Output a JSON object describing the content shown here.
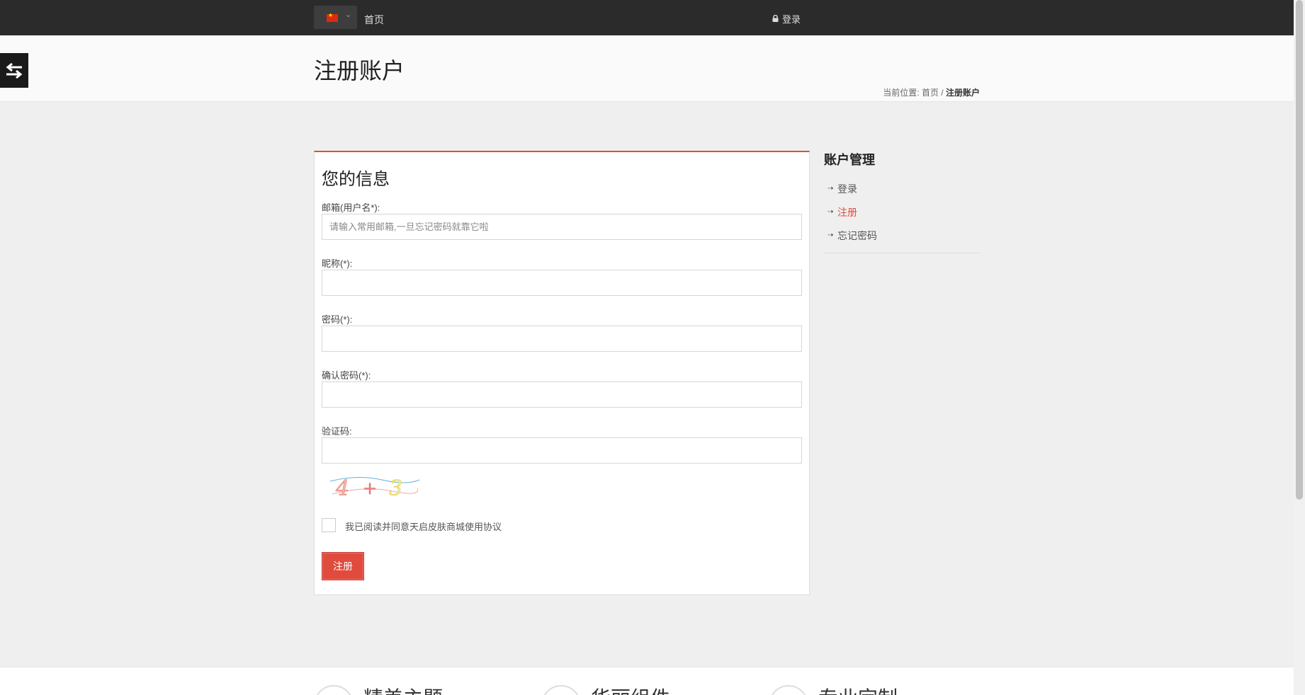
{
  "topbar": {
    "language": "zh-CN",
    "flag_icon": "china-flag-icon",
    "home": "首页",
    "login": "登录"
  },
  "page": {
    "title": "注册账户"
  },
  "breadcrumb": {
    "prefix": "当前位置:",
    "home": "首页",
    "separator": "/",
    "current": "注册账户"
  },
  "form": {
    "title": "您的信息",
    "email_label": "邮箱(用户名*):",
    "email_placeholder": "请输入常用邮箱,一旦忘记密码就靠它啦",
    "email_value": "",
    "nickname_label": "昵称(*):",
    "nickname_value": "",
    "password_label": "密码(*):",
    "confirm_label": "确认密码(*):",
    "captcha_label": "验证码:",
    "captcha_value": "",
    "captcha_image_text": "4 + 3",
    "agree_label": "我已阅读并同意天启皮肤商城使用协议",
    "agree_checked": false,
    "submit": "注册"
  },
  "sidebar": {
    "title": "账户管理",
    "items": [
      {
        "label": "登录",
        "active": false
      },
      {
        "label": "注册",
        "active": true
      },
      {
        "label": "忘记密码",
        "active": false
      }
    ]
  },
  "features": [
    {
      "title": "精美主题"
    },
    {
      "title": "华丽组件"
    },
    {
      "title": "专业定制"
    }
  ],
  "colors": {
    "accent": "#e04b3d",
    "topbar": "#2b2b2b",
    "background": "#efefef"
  }
}
